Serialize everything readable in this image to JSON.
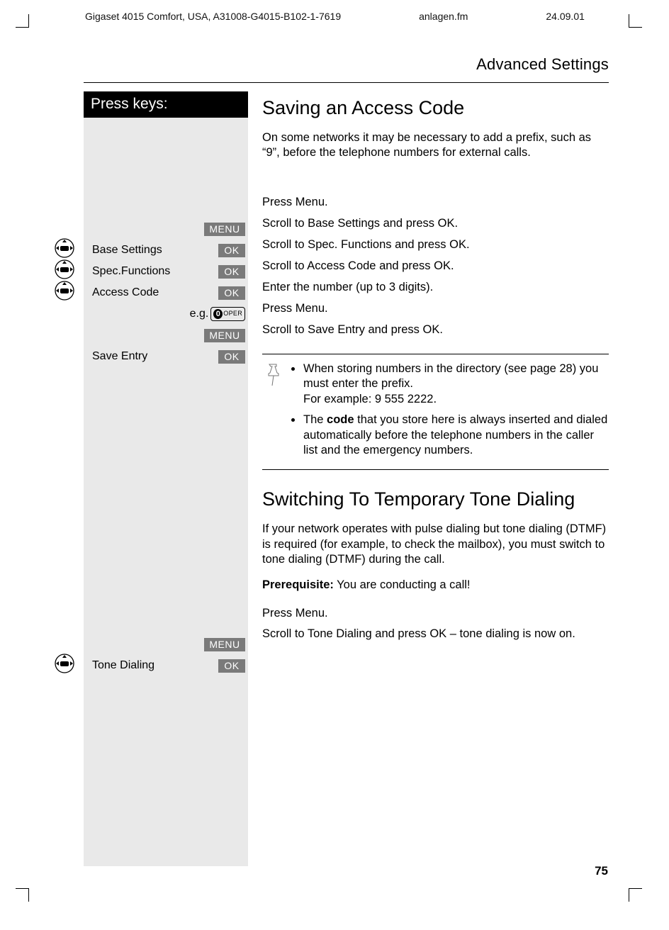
{
  "header": {
    "doc": "Gigaset 4015 Comfort, USA, A31008-G4015-B102-1-7619",
    "file": "anlagen.fm",
    "date": "24.09.01"
  },
  "breadcrumb": "Advanced Settings",
  "press_keys_label": "Press keys:",
  "tags": {
    "menu": "MENU",
    "ok": "OK"
  },
  "eg": "e.g.",
  "oper": "OPER",
  "left_labels": {
    "base_settings": "Base Settings",
    "spec_functions": "Spec.Functions",
    "access_code": "Access Code",
    "save_entry": "Save Entry",
    "tone_dialing": "Tone Dialing"
  },
  "section1": {
    "title": "Saving an Access Code",
    "intro": "On some networks it may be necessary to add a prefix, such as “9”, before the telephone numbers for external calls.",
    "steps": {
      "s1": "Press Menu.",
      "s2": "Scroll to Base Settings and press OK.",
      "s3": "Scroll to Spec. Functions and press OK.",
      "s4": "Scroll to Access Code and press OK.",
      "s5": "Enter the number (up to 3 digits).",
      "s6": "Press Menu.",
      "s7": "Scroll to Save Entry and press OK."
    },
    "note1a": "When storing numbers in the directory (see page 28) you must enter the prefix.",
    "note1b": "For example: 9 555 2222.",
    "note2_pre": "The ",
    "note2_bold": "code",
    "note2_post": " that you store here is always inser­ted and dialed automatically before the tele­phone numbers in the caller list and the emer­gency numbers."
  },
  "section2": {
    "title": "Switching To Temporary Tone Dialing",
    "intro": "If your network operates with pulse dialing but tone di­aling (DTMF) is required (for example, to check the mailbox), you must switch to tone dialing (DTMF) dur­ing the call.",
    "prereq_label": "Prerequisite:",
    "prereq_text": " You are conducting a call!",
    "steps": {
      "s1": "Press Menu.",
      "s2": "Scroll to Tone Dialing and press OK – tone dialing is now on."
    }
  },
  "page_number": "75"
}
